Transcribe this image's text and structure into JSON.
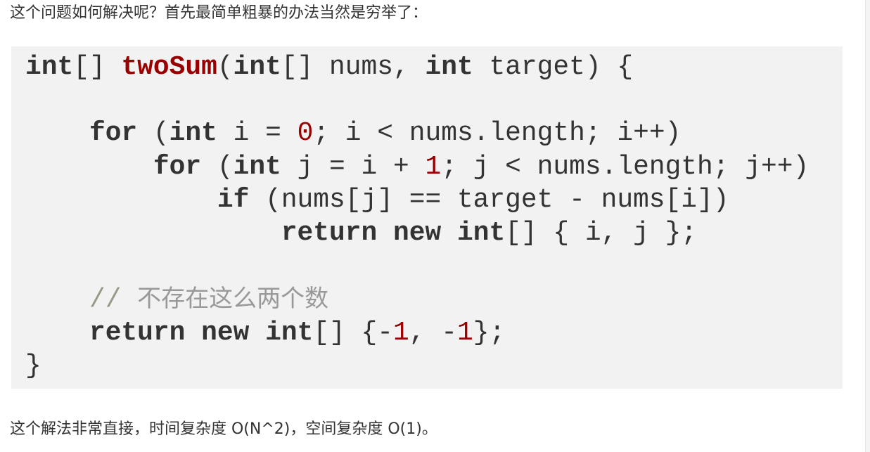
{
  "article": {
    "intro_text": "这个问题如何解决呢？首先最简单粗暴的办法当然是穷举了：",
    "conclusion_text": "这个解法非常直接，时间复杂度 O(N^2)，空间复杂度 O(1)。"
  },
  "code": {
    "line1": {
      "kw_int1": "int",
      "p1": "[] ",
      "fn_name": "twoSum",
      "p2": "(",
      "kw_int2": "int",
      "p3": "[] nums, ",
      "kw_int3": "int",
      "p4": " target) {"
    },
    "line3": {
      "indent": "    ",
      "kw_for": "for",
      "p1": " (",
      "kw_int": "int",
      "p2": " i = ",
      "num": "0",
      "p3": "; i < nums.length; i++)"
    },
    "line4": {
      "indent": "        ",
      "kw_for": "for",
      "p1": " (",
      "kw_int": "int",
      "p2": " j = i + ",
      "num": "1",
      "p3": "; j < nums.length; j++)"
    },
    "line5": {
      "indent": "            ",
      "kw_if": "if",
      "p1": " (nums[j] == target - nums[i])"
    },
    "line6": {
      "indent": "                ",
      "kw_return": "return",
      "p1": " ",
      "kw_new": "new",
      "p2": " ",
      "kw_int": "int",
      "p3": "[] { i, j };"
    },
    "line8": {
      "indent": "    ",
      "slashes": "// ",
      "comment": "不存在这么两个数"
    },
    "line9": {
      "indent": "    ",
      "kw_return": "return",
      "p1": " ",
      "kw_new": "new",
      "p2": " ",
      "kw_int": "int",
      "p3": "[] {-",
      "num1": "1",
      "p4": ", -",
      "num2": "1",
      "p5": "};"
    },
    "line10": {
      "brace": "}"
    }
  }
}
